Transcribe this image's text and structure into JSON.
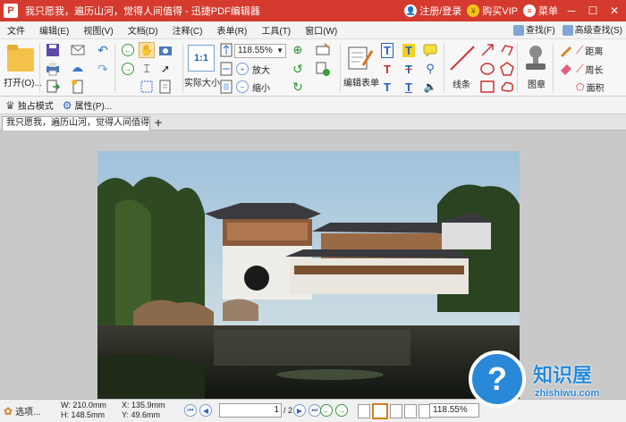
{
  "titlebar": {
    "logo": "P",
    "title": "我只愿我，遍历山河，觉得人间值得  -  迅捷PDF编辑器",
    "login": "注册/登录",
    "vip": "购买VIP",
    "menu": "菜单"
  },
  "menubar": {
    "items": [
      "文件",
      "编辑(E)",
      "视图(V)",
      "文档(D)",
      "注释(C)",
      "表单(R)",
      "工具(T)",
      "窗口(W)"
    ],
    "find": "查找(F)",
    "advanced_find": "高级查找(S)"
  },
  "ribbon": {
    "open": "打开(O)...",
    "zoom_value": "118.55%",
    "actual_size": "实际大小",
    "zoom_in": "放大",
    "zoom_out": "缩小",
    "edit_form": "编辑表单",
    "line": "线条",
    "stamp": "图章",
    "distance": "距离",
    "perimeter": "周长",
    "area": "面积"
  },
  "subbar": {
    "exclusive_mode": "独占模式",
    "properties": "属性(P)..."
  },
  "tabs": {
    "doc_tab": "我只愿我，遍历山河，觉得人间值得 *",
    "add": "+"
  },
  "statusbar": {
    "options": "选项...",
    "width": "W: 210.0mm",
    "height": "H: 148.5mm",
    "x": "X: 135.9mm",
    "y": "Y: 49.6mm",
    "page_value": "1",
    "page_total": "/ 2",
    "zoom_value": "118.55%"
  },
  "watermark": {
    "symbol": "?",
    "brand": "知识屋",
    "url": "zhishiwu.com"
  }
}
